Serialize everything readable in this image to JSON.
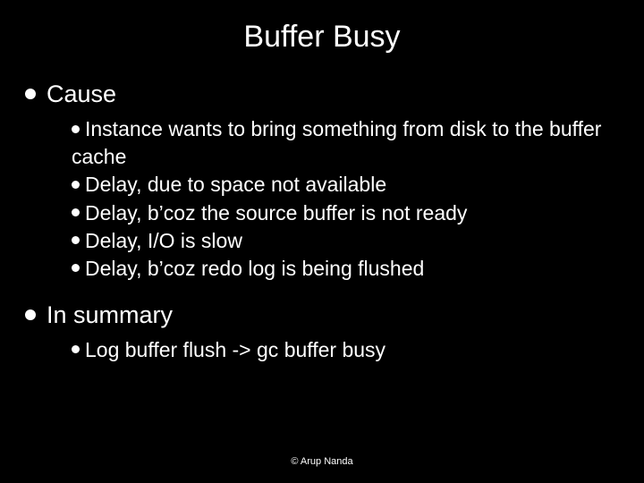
{
  "title": "Buffer Busy",
  "sections": [
    {
      "heading": "Cause",
      "items": [
        "Instance wants to bring something from disk to the buffer cache",
        "Delay, due to space not available",
        "Delay, b’coz the source buffer is not ready",
        "Delay, I/O is slow",
        "Delay, b’coz redo log is being flushed"
      ]
    },
    {
      "heading": "In summary",
      "items": [
        "Log buffer flush -> gc buffer busy"
      ]
    }
  ],
  "footer": "© Arup Nanda"
}
